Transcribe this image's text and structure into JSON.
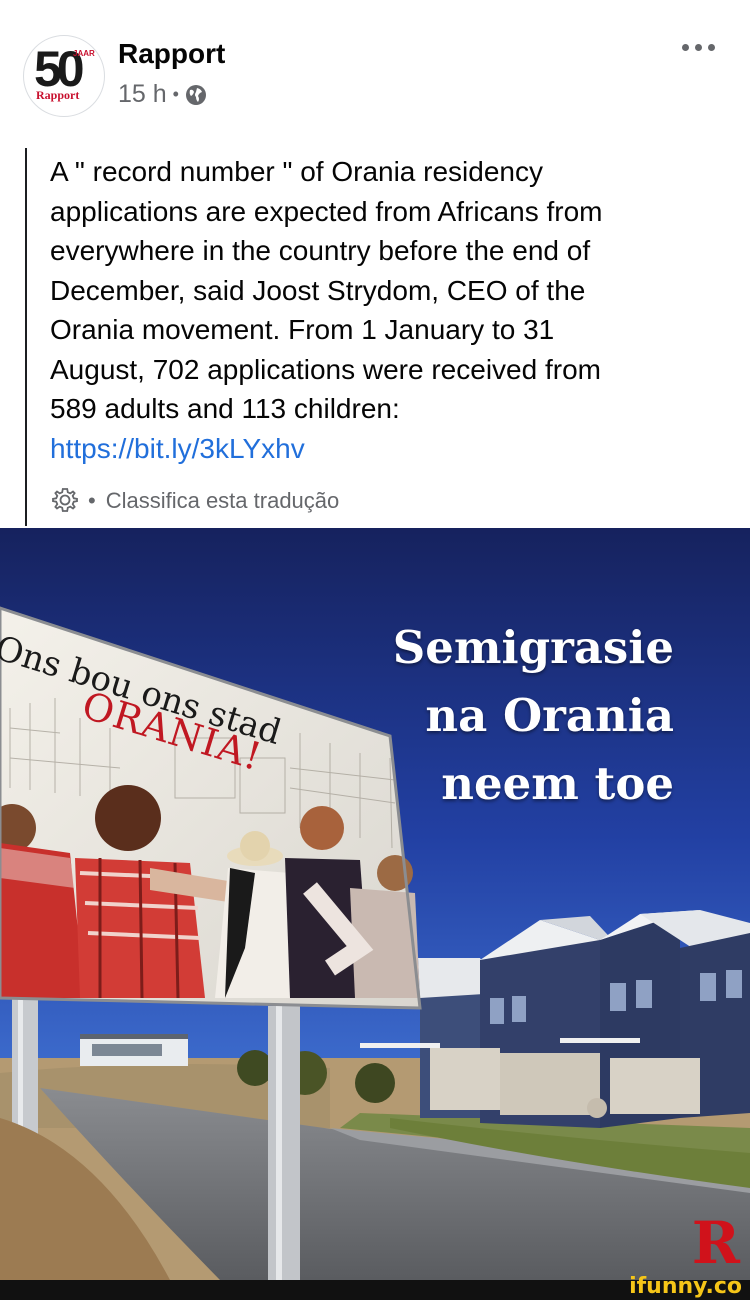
{
  "post": {
    "page_name": "Rapport",
    "avatar": {
      "anniversary_number": "50",
      "anniversary_word": "JAAR",
      "brand": "Rapport"
    },
    "time": "15 h",
    "meta_separator": "•",
    "privacy_icon": "globe-icon",
    "more_icon": "more-horizontal-icon",
    "body": "A \" record number \" of Orania residency\napplications are expected from Africans from\neverywhere in the country before the end of\nDecember, said Joost Strydom, CEO of the\nOrania movement. From 1 January to 31\nAugust, 702 applications were received from\n589 adults and 113 children:",
    "link": "https://bit.ly/3kLYxhv",
    "translate": {
      "icon": "gear-icon",
      "separator": "•",
      "label": "Classifica esta tradução"
    }
  },
  "image": {
    "headline": [
      "Semigrasie",
      "na Orania",
      "neem toe"
    ],
    "billboard": {
      "line1": "Ons bou ons stad",
      "line2": "ORANIA!"
    },
    "logo": "R"
  },
  "watermark": {
    "text": "ifunny.co"
  },
  "colors": {
    "link": "#216fdb",
    "secondary_text": "#65676b",
    "sky_top": "#1d2a6e",
    "sky_bottom": "#2a4db5",
    "brand_red": "#c8102e",
    "watermark_yellow": "#f5c518"
  }
}
